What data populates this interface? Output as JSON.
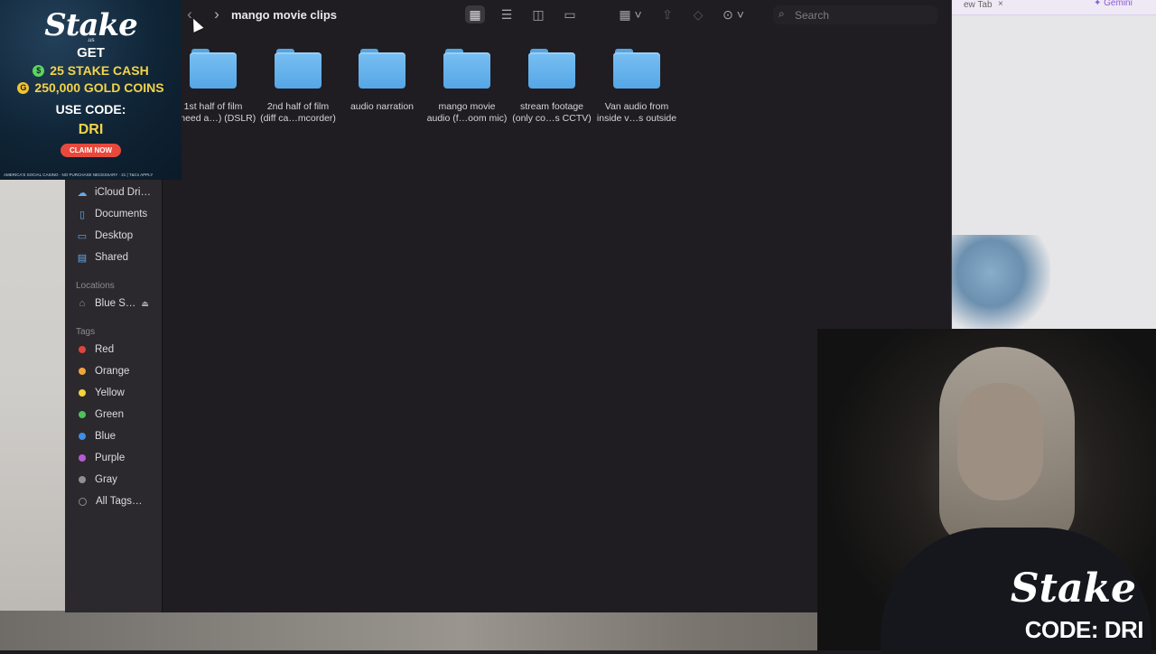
{
  "window": {
    "title": "mango movie clips"
  },
  "toolbar": {
    "back_icon": "chevron-left-icon",
    "forward_icon": "chevron-right-icon",
    "view_icons": [
      "grid-view-icon",
      "list-view-icon",
      "column-view-icon",
      "gallery-view-icon"
    ],
    "group_icon": "group-by-icon",
    "share_icon": "share-icon",
    "tag_icon": "tag-icon",
    "more_icon": "ellipsis-circle-icon",
    "search_placeholder": "Search"
  },
  "folders": [
    {
      "label": "1st half of film\n…need a…) (DSLR)"
    },
    {
      "label": "2nd half of film\n(diff ca…mcorder)"
    },
    {
      "label": "audio narration"
    },
    {
      "label": "mango movie\naudio (f…oom mic)"
    },
    {
      "label": "stream footage\n(only co…s CCTV)"
    },
    {
      "label": "Van audio from\ninside v…s outside"
    }
  ],
  "sidebar": {
    "favorites": [
      {
        "label": "iCloud Dri…",
        "icon": "cloud-icon"
      },
      {
        "label": "Documents",
        "icon": "document-icon"
      },
      {
        "label": "Desktop",
        "icon": "desktop-icon"
      },
      {
        "label": "Shared",
        "icon": "shared-folder-icon"
      }
    ],
    "locations_header": "Locations",
    "locations": [
      {
        "label": "Blue S…",
        "icon": "drive-icon"
      }
    ],
    "tags_header": "Tags",
    "tags": [
      {
        "label": "Red",
        "color": "#e0443e"
      },
      {
        "label": "Orange",
        "color": "#f0a43a"
      },
      {
        "label": "Yellow",
        "color": "#f2d43b"
      },
      {
        "label": "Green",
        "color": "#4fc15b"
      },
      {
        "label": "Blue",
        "color": "#3f8fe0"
      },
      {
        "label": "Purple",
        "color": "#b55ad6"
      },
      {
        "label": "Gray",
        "color": "#8e8e93"
      },
      {
        "label": "All Tags…",
        "color": ""
      }
    ]
  },
  "ad": {
    "logo": "Stake",
    "logo_sub": ".us",
    "get": "GET",
    "offer1": "25 STAKE CASH",
    "offer2": "250,000 GOLD COINS",
    "use_code": "USE CODE:",
    "code": "DRI",
    "button": "CLAIM NOW",
    "fine_print": "AMERICA'S SOCIAL CASINO · NO PURCHASE NECESSARY · 21 | T&Cs APPLY"
  },
  "browser": {
    "tab_text": "ew Tab",
    "gemini": "✦ Gemini"
  },
  "webcam": {
    "logo": "Stake",
    "code": "CODE: DRI"
  }
}
